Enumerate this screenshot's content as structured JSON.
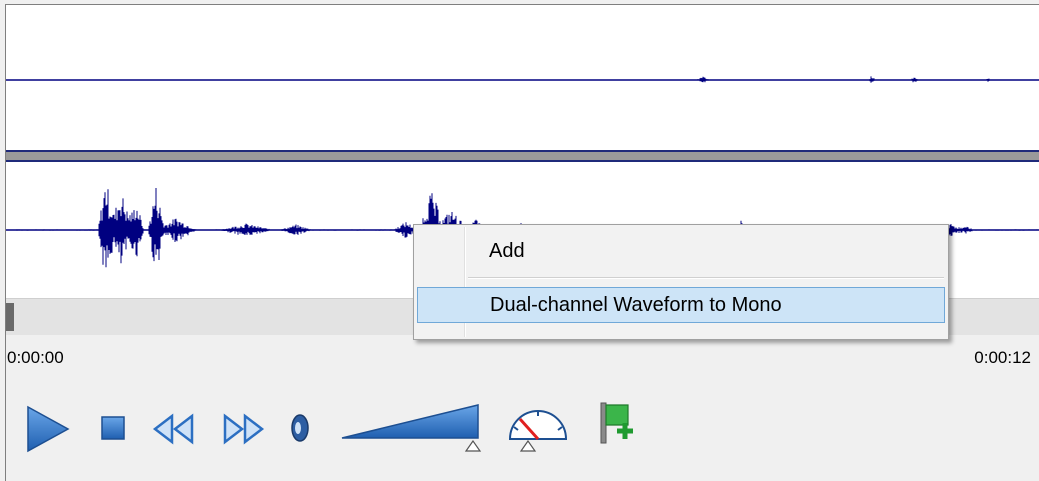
{
  "player": {
    "time_start": "0:00:00",
    "time_end": "0:00:12"
  },
  "context_menu": {
    "items": [
      {
        "label": "Add"
      },
      {
        "label": "Dual-channel Waveform to Mono",
        "highlighted": true
      }
    ]
  },
  "toolbar": {
    "buttons": [
      "play-icon",
      "stop-icon",
      "rewind-icon",
      "fast-forward-icon",
      "speaker-icon",
      "volume-slider",
      "speed-gauge-icon",
      "add-marker-flag-icon"
    ]
  },
  "colors": {
    "waveform": "#000080",
    "menu_highlight": "#cde4f7",
    "icon_blue": "#2c6fc2"
  }
}
